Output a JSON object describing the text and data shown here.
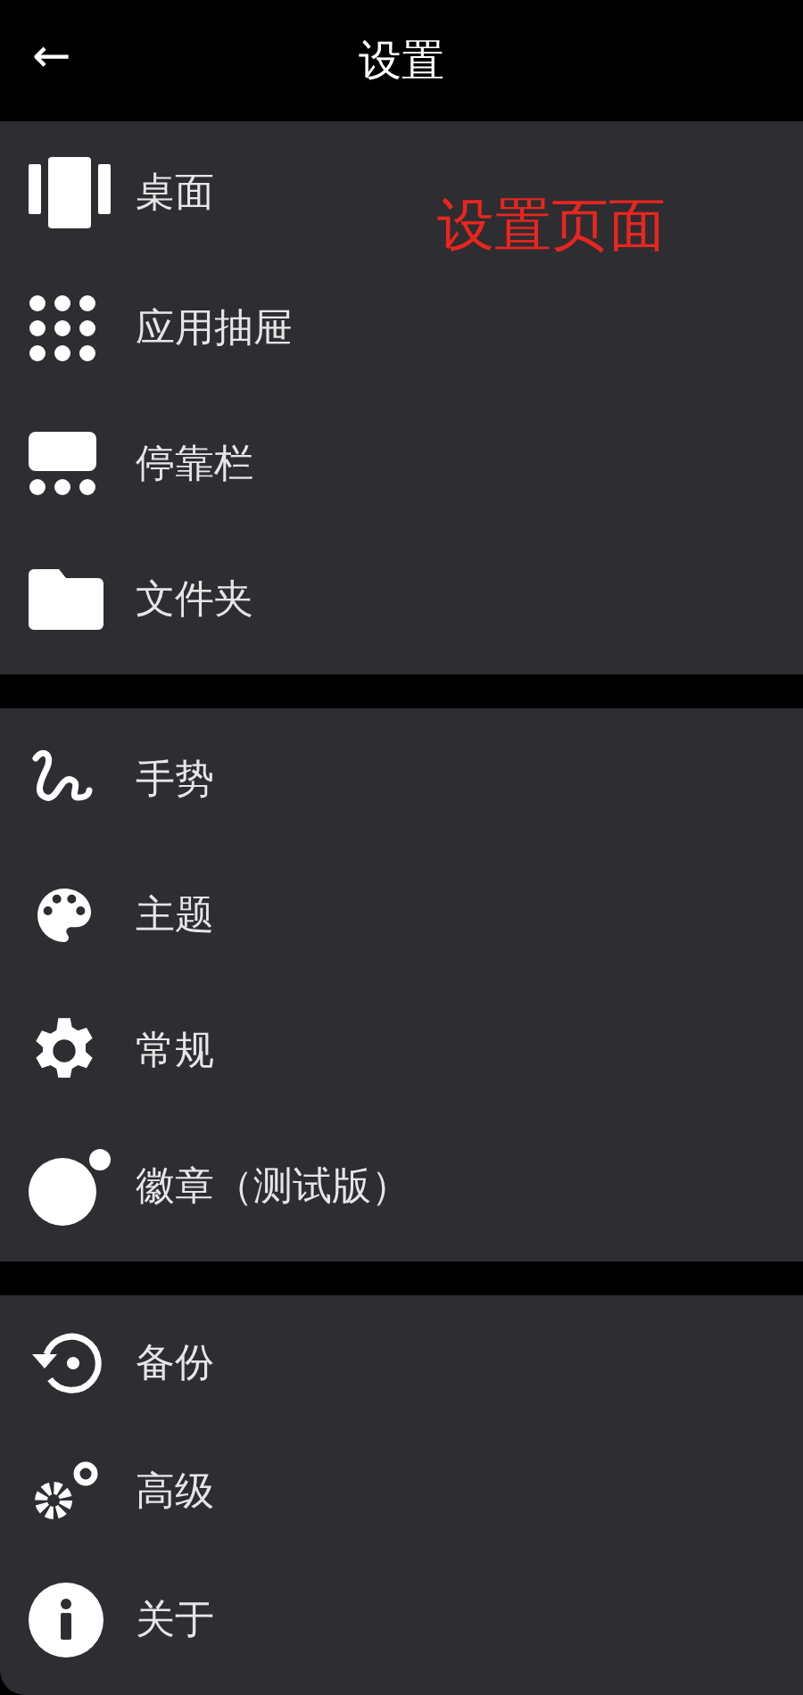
{
  "header": {
    "back_icon": "←",
    "title": "设置"
  },
  "annotation": "设置页面",
  "sections": [
    {
      "items": [
        {
          "kind": "desktop",
          "label": "桌面"
        },
        {
          "kind": "grid",
          "label": "应用抽屉"
        },
        {
          "kind": "dock",
          "label": "停靠栏"
        },
        {
          "kind": "folder",
          "label": "文件夹"
        }
      ]
    },
    {
      "items": [
        {
          "kind": "gesture",
          "label": "手势"
        },
        {
          "kind": "palette",
          "label": "主题"
        },
        {
          "kind": "gear",
          "label": "常规"
        },
        {
          "kind": "badge",
          "label": "徽章（测试版）"
        }
      ]
    },
    {
      "items": [
        {
          "kind": "backup",
          "label": "备份"
        },
        {
          "kind": "gears",
          "label": "高级"
        },
        {
          "kind": "info",
          "label": "关于"
        }
      ]
    }
  ]
}
